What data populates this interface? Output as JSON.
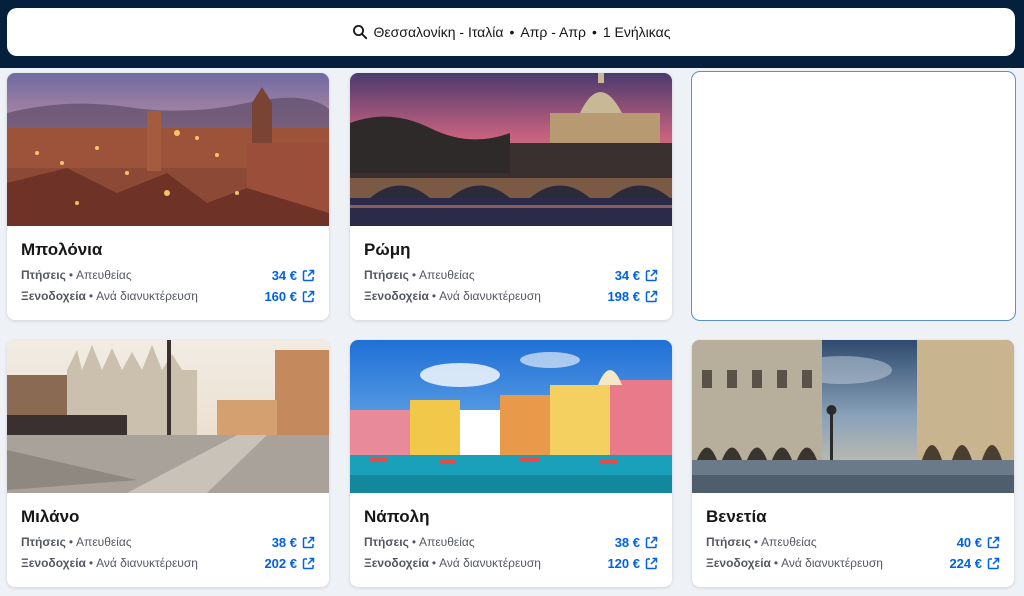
{
  "search": {
    "destination": "Θεσσαλονίκη - Ιταλία",
    "dates": "Απρ - Απρ",
    "travellers": "1 Ενήλικας",
    "separator": "•"
  },
  "cards": [
    {
      "city": "Μπολόνια",
      "flights_label": "Πτήσεις",
      "flights_detail": "Απευθείας",
      "flights_price": "34 €",
      "hotels_label": "Ξενοδοχεία",
      "hotels_detail": "Ανά διανυκτέρευση",
      "hotels_price": "160 €"
    },
    {
      "city": "Ρώμη",
      "flights_label": "Πτήσεις",
      "flights_detail": "Απευθείας",
      "flights_price": "34 €",
      "hotels_label": "Ξενοδοχεία",
      "hotels_detail": "Ανά διανυκτέρευση",
      "hotels_price": "198 €"
    },
    {
      "city": "Μιλάνο",
      "flights_label": "Πτήσεις",
      "flights_detail": "Απευθείας",
      "flights_price": "38 €",
      "hotels_label": "Ξενοδοχεία",
      "hotels_detail": "Ανά διανυκτέρευση",
      "hotels_price": "202 €"
    },
    {
      "city": "Νάπολη",
      "flights_label": "Πτήσεις",
      "flights_detail": "Απευθείας",
      "flights_price": "38 €",
      "hotels_label": "Ξενοδοχεία",
      "hotels_detail": "Ανά διανυκτέρευση",
      "hotels_price": "120 €"
    },
    {
      "city": "Βενετία",
      "flights_label": "Πτήσεις",
      "flights_detail": "Απευθείας",
      "flights_price": "40 €",
      "hotels_label": "Ξενοδοχεία",
      "hotels_detail": "Ανά διανυκτέρευση",
      "hotels_price": "224 €"
    }
  ],
  "colors": {
    "header_bg": "#05203c",
    "price": "#0062e3",
    "page_bg": "#eef1f6"
  },
  "icons": [
    "search-icon",
    "external-link-icon"
  ]
}
